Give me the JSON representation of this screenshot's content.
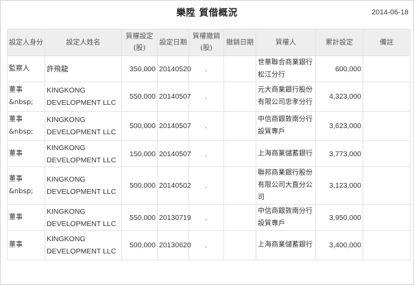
{
  "page": {
    "title": "樂陞 質借概況",
    "date": "2014-06-18"
  },
  "table": {
    "headers": [
      "設定人身分",
      "設定人姓名",
      "質權設定(股)",
      "設定日期",
      "質權撤銷(股)",
      "撤銷日期",
      "質權人",
      "累計設定",
      "備註"
    ],
    "rows": [
      [
        "監察人",
        "許飛龍",
        "350,000",
        "20140520",
        ".",
        "",
        "世華聯合商業銀行松江分行",
        "600,000",
        ""
      ],
      [
        "董事&nbsp;",
        "KINGKONG DEVELOPMENT LLC",
        "550,000",
        "20140507",
        ".",
        "",
        "元大商業銀行股份有限公司忠孝分行",
        "4,323,000",
        ""
      ],
      [
        "董事&nbsp;",
        "KINGKONG DEVELOPMENT LLC",
        "500,000",
        "20140507",
        ".",
        "",
        "中信商銀敦南分行設質專戶",
        "3,623,000",
        ""
      ],
      [
        "董事",
        "KINGKONG DEVELOPMENT LLC",
        "150,000",
        "20140507",
        ".",
        "",
        "上海商業儲蓄銀行",
        "3,773,000",
        ""
      ],
      [
        "董事&nbsp;",
        "KINGKONG DEVELOPMENT LLC",
        "500,000",
        "20140502",
        ".",
        "",
        "聯邦商業銀行股份有限公司大直分公司",
        "3,123,000",
        ""
      ],
      [
        "董事",
        "KINGKONG DEVELOPMENT LLC",
        "550,000",
        "20130719",
        ".",
        "",
        "中信商銀敦南分行設質專戶",
        "3,950,000",
        ""
      ],
      [
        "董事",
        "KINGKONG DEVELOPMENT LLC",
        "500,000",
        "20130620",
        ".",
        "",
        "上海商業儲蓄銀行",
        "3,400,000",
        ""
      ]
    ]
  }
}
